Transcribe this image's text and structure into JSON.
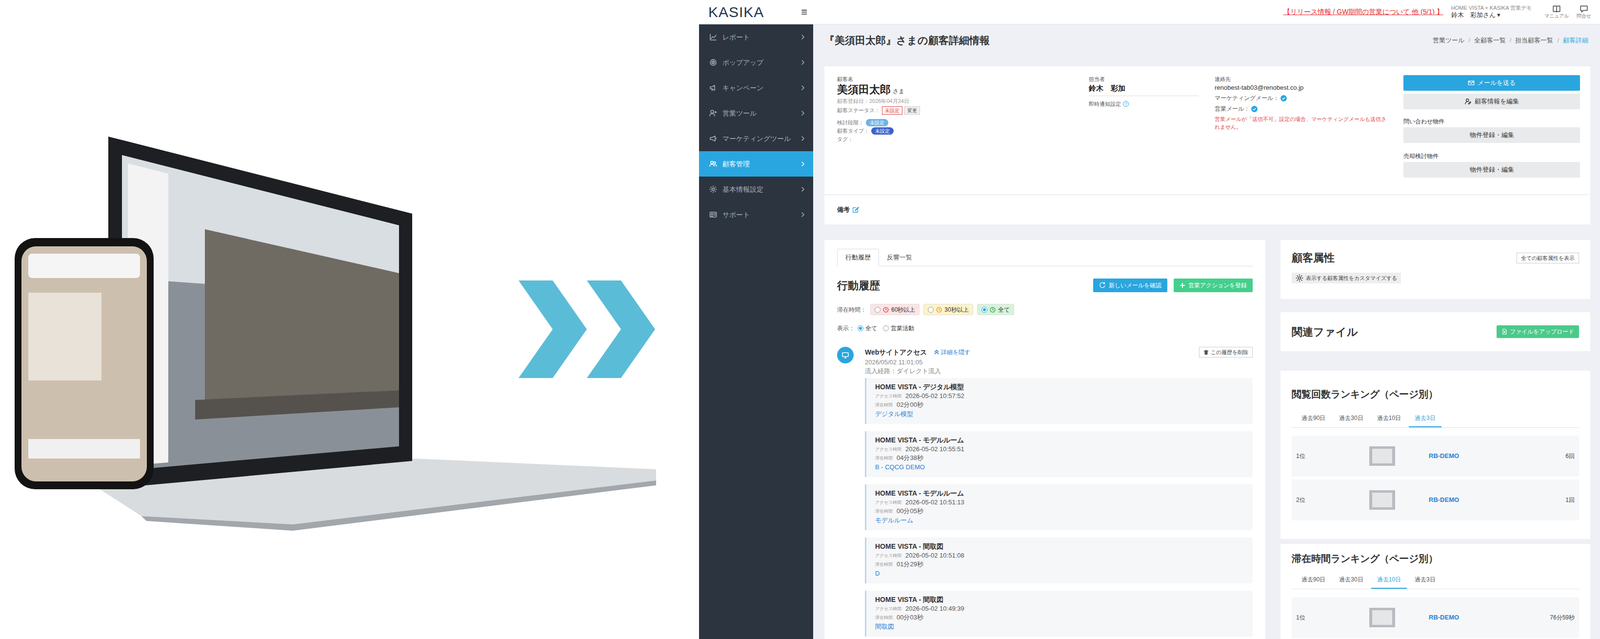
{
  "header": {
    "logo": "KASIKA",
    "menu_icon": "≡",
    "notice": "【リリース情報 / GW期間の営業について 他 (5/1) 】",
    "company": "HOME VISTA × KASIKA 営業デモ",
    "user": "鈴木　彩加さん ▾",
    "links": [
      {
        "label": "マニュアル"
      },
      {
        "label": "問合せ"
      }
    ]
  },
  "sidebar": {
    "items": [
      {
        "label": "レポート",
        "selected": false
      },
      {
        "label": "ポップアップ",
        "selected": false
      },
      {
        "label": "キャンペーン",
        "selected": false
      },
      {
        "label": "営業ツール",
        "selected": false
      },
      {
        "label": "マーケティングツール",
        "selected": false
      },
      {
        "label": "顧客管理",
        "selected": true
      },
      {
        "label": "基本情報設定",
        "selected": false
      },
      {
        "label": "サポート",
        "selected": false
      }
    ]
  },
  "page": {
    "title": "『美須田太郎』さまの顧客詳細情報",
    "separator": "/",
    "breadcrumb": [
      {
        "label": "営業ツール",
        "selected": false
      },
      {
        "label": "全顧客一覧",
        "selected": false
      },
      {
        "label": "担当顧客一覧",
        "selected": false
      },
      {
        "label": "顧客詳細",
        "selected": true
      }
    ]
  },
  "customer": {
    "name_label": "顧客名",
    "name": "美須田太郎",
    "honorific": "さま",
    "registered": "顧客登録日：2026年04月24日",
    "status_label": "顧客ステータス：",
    "status": "未設定",
    "status_button": "変更",
    "fields": [
      {
        "label": "検討段階：",
        "value": "未設定",
        "color": "#6cb4ea"
      },
      {
        "label": "顧客タイプ：",
        "value": "未設定",
        "color": "#3d63c9"
      }
    ],
    "tag_label": "タグ：",
    "owner_label": "担当者",
    "owner": "鈴木　彩加",
    "notify_label": "即時通知設定",
    "notify_help": "?",
    "notify_on": true,
    "contact_label": "連絡先",
    "email": "renobest-tab03@renobest.co.jp",
    "marketing_mail_label": "マーケティングメール：",
    "marketing_mail": true,
    "sales_mail_label": "営業メール：",
    "sales_mail": true,
    "warning": "営業メールが「送信不可」設定の場合、マーケティングメールも送信されません。",
    "send_mail": "メールを送る",
    "edit": "顧客情報を編集",
    "inquiry_label": "問い合わせ物件",
    "inquiry_button": "物件登録・編集",
    "sale_label": "売却検討物件",
    "sale_button": "物件登録・編集"
  },
  "notes": {
    "label": "備考"
  },
  "history": {
    "tabs": [
      {
        "label": "行動履歴",
        "selected": true
      },
      {
        "label": "反響一覧",
        "selected": false
      }
    ],
    "title": "行動履歴",
    "check_mail": "新しいメールを確認",
    "add_action": "営業アクションを登録",
    "duration_label": "滞在時間：",
    "duration_filters": [
      {
        "label": "60秒以上",
        "selected": false,
        "color": "#fde4e4",
        "icon_color": "#e05555"
      },
      {
        "label": "30秒以上",
        "selected": false,
        "color": "#fdf3c9",
        "icon_color": "#e6a23c"
      },
      {
        "label": "全て",
        "selected": true,
        "color": "#d7f3da",
        "icon_color": "#3cae5c"
      }
    ],
    "display_label": "表示：",
    "display_filters": [
      {
        "label": "全て",
        "selected": true
      },
      {
        "label": "営業活動",
        "selected": false
      }
    ],
    "entry": {
      "title": "Webサイトアクセス",
      "toggle": "詳細を隠す",
      "delete": "この履歴を削除",
      "date": "2026/05/02 11:01:05",
      "source": "流入経路：ダイレクト流入",
      "pages": [
        {
          "title": "HOME VISTA - デジタル模型",
          "access_label": "アクセス時間",
          "access": "2026-05-02 10:57:52",
          "stay_label": "滞在時間",
          "stay": "02分00秒",
          "link": "デジタル模型"
        },
        {
          "title": "HOME VISTA - モデルルーム",
          "access_label": "アクセス時間",
          "access": "2026-05-02 10:55:51",
          "stay_label": "滞在時間",
          "stay": "04分38秒",
          "link": "B - CQCG DEMO"
        },
        {
          "title": "HOME VISTA - モデルルーム",
          "access_label": "アクセス時間",
          "access": "2026-05-02 10:51:13",
          "stay_label": "滞在時間",
          "stay": "00分05秒",
          "link": "モデルルーム"
        },
        {
          "title": "HOME VISTA - 間取図",
          "access_label": "アクセス時間",
          "access": "2026-05-02 10:51:08",
          "stay_label": "滞在時間",
          "stay": "01分29秒",
          "link": "D"
        },
        {
          "title": "HOME VISTA - 間取図",
          "access_label": "アクセス時間",
          "access": "2026-05-02 10:49:39",
          "stay_label": "滞在時間",
          "stay": "00分03秒",
          "link": "間取図"
        }
      ]
    }
  },
  "attributes": {
    "title": "顧客属性",
    "show_all": "全ての顧客属性を表示",
    "customize": "表示する顧客属性をカスタマイズする"
  },
  "files": {
    "title": "関連ファイル",
    "upload": "ファイルをアップロード"
  },
  "rankings": [
    {
      "title": "閲覧回数ランキング（ページ別）",
      "tabs": [
        {
          "label": "過去90日",
          "selected": false
        },
        {
          "label": "過去30日",
          "selected": false
        },
        {
          "label": "過去10日",
          "selected": false
        },
        {
          "label": "過去3日",
          "selected": true
        }
      ],
      "rows": [
        {
          "rank": "1位",
          "name": "RB-DEMO",
          "value": "6回"
        },
        {
          "rank": "2位",
          "name": "RB-DEMO",
          "value": "1回"
        }
      ]
    },
    {
      "title": "滞在時間ランキング（ページ別）",
      "tabs": [
        {
          "label": "過去90日",
          "selected": false
        },
        {
          "label": "過去30日",
          "selected": false
        },
        {
          "label": "過去10日",
          "selected": true
        },
        {
          "label": "過去3日",
          "selected": false
        }
      ],
      "rows": [
        {
          "rank": "1位",
          "name": "RB-DEMO",
          "value": "76分59秒"
        }
      ]
    }
  ]
}
